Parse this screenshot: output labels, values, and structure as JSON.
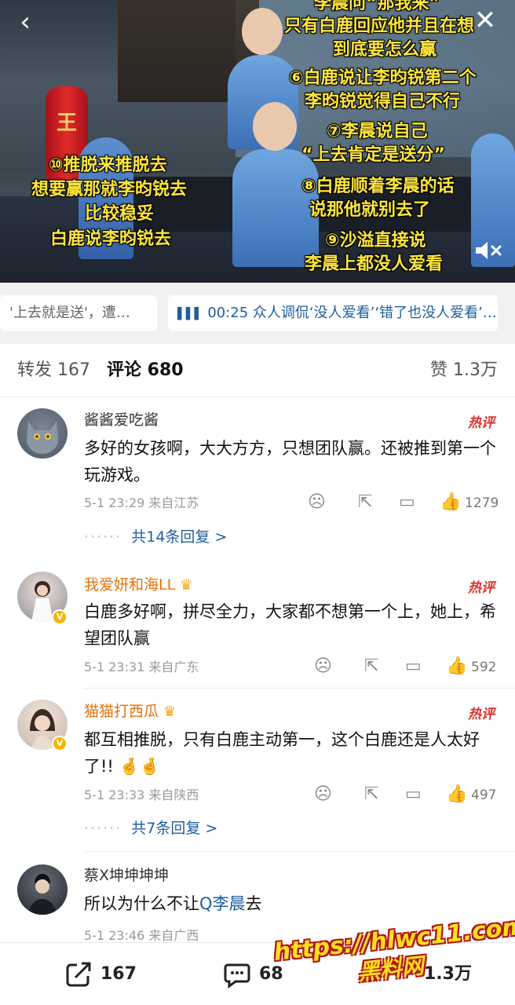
{
  "video": {
    "bottle_label": "王",
    "overlay_right": [
      "李晨问“那我来”",
      "只有白鹿回应他并且在想",
      "到底要怎么赢",
      "⑥白鹿说让李昀锐第二个",
      "李昀锐觉得自己不行",
      "⑦李晨说自己",
      "“上去肯定是送分”",
      "⑧白鹿顺着李晨的话",
      "说那他就别去了",
      "⑨沙溢直接说",
      "李晨上都没人爱看"
    ],
    "overlay_left": [
      "⑩推脱来推脱去",
      "想要赢那就李昀锐去",
      "比较稳妥",
      "白鹿说李昀锐去"
    ]
  },
  "chips": [
    {
      "text": "'上去就是送'，遭…"
    },
    {
      "icon": "audio-bars-icon",
      "text": "00:25 众人调侃‘没人爱看’‘错了也没人爱看’…"
    }
  ],
  "tabs": {
    "repost": "转发 167",
    "comment": "评论 680",
    "like": "赞 1.3万"
  },
  "comments": [
    {
      "name": "酱酱爱吃酱",
      "hot": "热评",
      "text": "多好的女孩啊，大大方方，只想团队赢。还被推到第一个玩游戏。",
      "meta": "5-1 23:29  来自江苏",
      "likes": "1279",
      "replies": "共14条回复 >"
    },
    {
      "name": "我爱妍和海LL",
      "hot": "热评",
      "text": "白鹿多好啊，拼尽全力，大家都不想第一个上，她上，希望团队赢",
      "meta": "5-1 23:31  来自广东",
      "likes": "592"
    },
    {
      "name": "猫猫打西瓜",
      "hot": "热评",
      "text": "都互相推脱，只有白鹿主动第一，这个白鹿还是人太好了!! 🤞🤞",
      "meta": "5-1 23:33  来自陕西",
      "likes": "497",
      "replies": "共7条回复 >"
    },
    {
      "name": "蔡X坤坤坤坤",
      "text_prefix": "所以为什么不让",
      "mention": "Q李晨",
      "text_suffix": "去",
      "meta": "5-1 23:46  来自广西"
    }
  ],
  "bottombar": {
    "repost_count": "167",
    "comment_count": "68",
    "like_count": "1.3万"
  },
  "watermark": {
    "line1": "https://hlwc11.com",
    "line2": "黑料网"
  },
  "colors": {
    "overlay_text": "#ffe63a",
    "link_blue": "#1e5e9e",
    "hot_red": "#e0302b",
    "vip_orange": "#e8720c"
  }
}
